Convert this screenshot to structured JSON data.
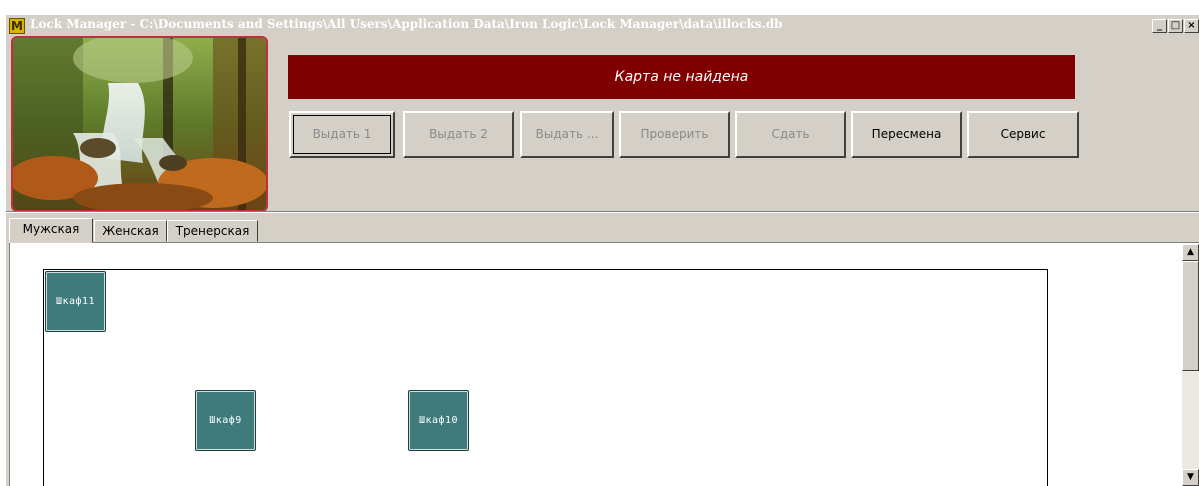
{
  "window": {
    "app_icon_glyph": "M",
    "title": "Lock Manager - C:\\Documents and Settings\\All Users\\Application Data\\Iron Logic\\Lock Manager\\data\\illocks.db",
    "controls": {
      "minimize": "_",
      "maximize": "□",
      "close": "×"
    }
  },
  "status": {
    "message": "Карта не найдена",
    "color": "#800000"
  },
  "toolbar": {
    "buttons": [
      {
        "label": "Выдать 1",
        "enabled": false
      },
      {
        "label": "Выдать 2",
        "enabled": false
      },
      {
        "label": "Выдать ...",
        "enabled": false
      },
      {
        "label": "Проверить",
        "enabled": false
      },
      {
        "label": "Сдать",
        "enabled": false
      },
      {
        "label": "Пересмена",
        "enabled": true
      },
      {
        "label": "Сервис",
        "enabled": true
      }
    ]
  },
  "tabs": [
    {
      "label": "Мужская",
      "active": true
    },
    {
      "label": "Женская",
      "active": false
    },
    {
      "label": "Тренерская",
      "active": false
    }
  ],
  "lockers": [
    {
      "label": "Шкаф11"
    },
    {
      "label": "Шкаф9"
    },
    {
      "label": "Шкаф10"
    }
  ],
  "locker_color": "#3f7b7c",
  "scrollbar": {
    "up_arrow": "▲",
    "down_arrow": "▼"
  }
}
